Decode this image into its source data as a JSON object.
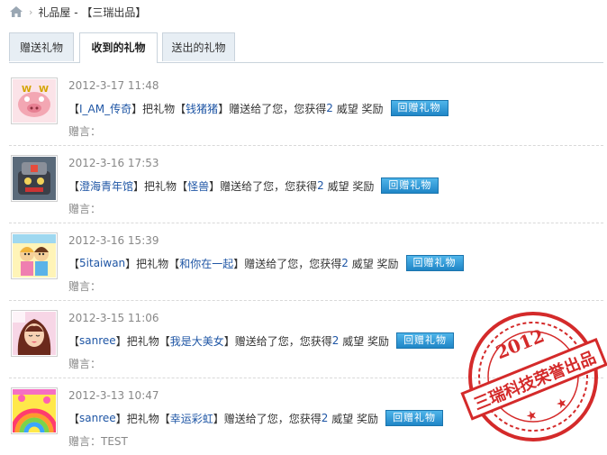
{
  "breadcrumb": {
    "sep": "›",
    "title": "礼品屋 - 【三瑞出品】"
  },
  "tabs": [
    {
      "label": "赠送礼物"
    },
    {
      "label": "收到的礼物"
    },
    {
      "label": "送出的礼物"
    }
  ],
  "gifts": [
    {
      "time": "2012-3-17 11:48",
      "sender": "I_AM_传奇",
      "gift": "钱猪猪",
      "points": "2",
      "message": ""
    },
    {
      "time": "2012-3-16 17:53",
      "sender": "澄海青年馆",
      "gift": "怪兽",
      "points": "2",
      "message": ""
    },
    {
      "time": "2012-3-16 15:39",
      "sender": "5itaiwan",
      "gift": "和你在一起",
      "points": "2",
      "message": ""
    },
    {
      "time": "2012-3-15 11:06",
      "sender": "sanree",
      "gift": "我是大美女",
      "points": "2",
      "message": ""
    },
    {
      "time": "2012-3-13 10:47",
      "sender": "sanree",
      "gift": "幸运彩虹",
      "points": "2",
      "message": "TEST"
    }
  ],
  "text": {
    "lb": "【",
    "rb": "】",
    "gift_prefix": "把礼物",
    "gift_suffix": "赠送给了您，您获得",
    "points_suffix": "威望 奖励",
    "reply_label": "回赠礼物",
    "message_label": "赠言："
  },
  "stamp": {
    "year": "2012",
    "text": "三瑞科技荣誉出品"
  },
  "colors": {
    "accent": "#1f56a5",
    "button": "#2a93d2",
    "stamp": "#d42a2a"
  }
}
